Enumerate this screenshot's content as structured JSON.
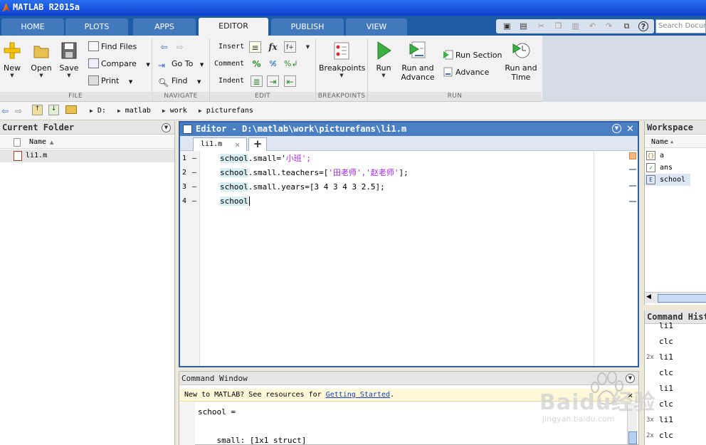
{
  "window": {
    "title": "MATLAB R2015a"
  },
  "tabs": [
    {
      "label": "HOME"
    },
    {
      "label": "PLOTS"
    },
    {
      "label": "APPS"
    },
    {
      "label": "EDITOR"
    },
    {
      "label": "PUBLISH"
    },
    {
      "label": "VIEW"
    }
  ],
  "search": {
    "placeholder": "Search Documentation"
  },
  "ribbon": {
    "file": {
      "section": "FILE",
      "new": "New",
      "open": "Open",
      "save": "Save",
      "find_files": "Find Files",
      "compare": "Compare",
      "print": "Print"
    },
    "navigate": {
      "section": "NAVIGATE",
      "go_to": "Go To",
      "find": "Find"
    },
    "edit": {
      "section": "EDIT",
      "insert": "Insert",
      "comment": "Comment",
      "indent": "Indent"
    },
    "breakpoints": {
      "section": "BREAKPOINTS",
      "breakpoints": "Breakpoints"
    },
    "run": {
      "section": "RUN",
      "run": "Run",
      "run_and_advance_1": "Run and",
      "run_and_advance_2": "Advance",
      "run_section": "Run Section",
      "advance": "Advance",
      "run_and_time_1": "Run and",
      "run_and_time_2": "Time"
    }
  },
  "address": {
    "segments": [
      "D:",
      "matlab",
      "work",
      "picturefans"
    ]
  },
  "current_folder": {
    "title": "Current Folder",
    "col_name": "Name",
    "files": [
      {
        "name": "li1.m"
      }
    ]
  },
  "editor": {
    "title": "Editor - D:\\matlab\\work\\picturefans\\li1.m",
    "tab": "li1.m",
    "lines": [
      {
        "n": "1",
        "obj": "school",
        "rest": ".small='",
        "str": "小班",
        "end": "';"
      },
      {
        "n": "2",
        "obj": "school",
        "rest": ".small.teachers=[",
        "str": "'田老师','赵老师'",
        "end": "];"
      },
      {
        "n": "3",
        "obj": "school",
        "rest": ".small.years=[3 4 3 4 3 2.5];",
        "str": "",
        "end": ""
      },
      {
        "n": "4",
        "obj": "school",
        "rest": "",
        "str": "",
        "end": ""
      }
    ]
  },
  "command_window": {
    "title": "Command Window",
    "info_prefix": "New to MATLAB? See resources for ",
    "info_link": "Getting Started",
    "info_suffix": ".",
    "output": [
      "school =",
      "",
      "    small: [1x1 struct]"
    ]
  },
  "workspace": {
    "title": "Workspace",
    "col_name": "Name",
    "vars": [
      {
        "name": "a",
        "icon": "{}"
      },
      {
        "name": "ans",
        "icon": "✓"
      },
      {
        "name": "school",
        "icon": "E"
      }
    ]
  },
  "command_history": {
    "title": "Command History",
    "entries": [
      {
        "count": "",
        "cmd": "li1"
      },
      {
        "count": "",
        "cmd": "clc"
      },
      {
        "count": "2x",
        "cmd": "li1"
      },
      {
        "count": "",
        "cmd": "clc"
      },
      {
        "count": "",
        "cmd": "li1"
      },
      {
        "count": "",
        "cmd": "clc"
      },
      {
        "count": "3x",
        "cmd": "li1"
      },
      {
        "count": "2x",
        "cmd": "clc"
      }
    ]
  },
  "watermark": {
    "text1": "Baidu经验",
    "text2": "jingyan.baidu.com"
  },
  "colors": {
    "tabbar": "#1f5ca6",
    "editor_header": "#4a7fc4",
    "string": "#a020f0",
    "link": "#1040c0"
  }
}
